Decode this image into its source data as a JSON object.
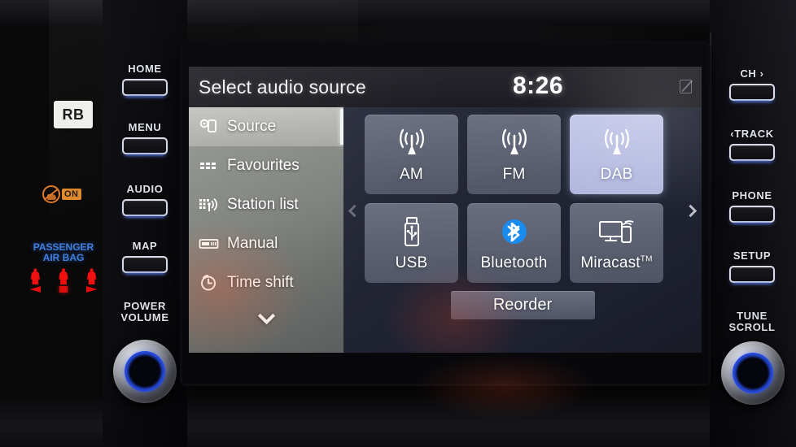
{
  "screen": {
    "title": "Select audio source",
    "clock": "8:26",
    "status_icon": "no-signal-icon"
  },
  "sidebar": {
    "items": [
      {
        "label": "Source",
        "icon": "source-icon",
        "active": true
      },
      {
        "label": "Favourites",
        "icon": "favourites-icon",
        "active": false
      },
      {
        "label": "Station list",
        "icon": "station-list-icon",
        "active": false
      },
      {
        "label": "Manual",
        "icon": "manual-icon",
        "active": false
      },
      {
        "label": "Time shift",
        "icon": "time-shift-icon",
        "active": false
      }
    ],
    "more_icon": "chevron-down-icon"
  },
  "sources": {
    "row1": [
      {
        "label": "AM",
        "icon": "radio-antenna-icon",
        "selected": false
      },
      {
        "label": "FM",
        "icon": "radio-antenna-icon",
        "selected": false
      },
      {
        "label": "DAB",
        "icon": "radio-antenna-icon",
        "selected": true
      }
    ],
    "row2": [
      {
        "label": "USB",
        "icon": "usb-stick-icon",
        "selected": false
      },
      {
        "label": "Bluetooth",
        "icon": "bluetooth-icon",
        "selected": false
      },
      {
        "label": "Miracast",
        "icon": "miracast-icon",
        "selected": false,
        "suffix": "TM"
      }
    ],
    "prev_icon": "chevron-left-icon",
    "next_icon": "chevron-right-icon",
    "reorder_label": "Reorder"
  },
  "hardware": {
    "left": [
      {
        "label": "HOME"
      },
      {
        "label": "MENU"
      },
      {
        "label": "AUDIO"
      },
      {
        "label": "MAP"
      }
    ],
    "left_knob_label_line1": "POWER",
    "left_knob_label_line2": "VOLUME",
    "right": [
      {
        "label": "CH ›"
      },
      {
        "label": "‹TRACK"
      },
      {
        "label": "PHONE"
      },
      {
        "label": "SETUP"
      }
    ],
    "right_knob_label_line1": "TUNE",
    "right_knob_label_line2": "SCROLL"
  },
  "dash_indicators": {
    "rb_badge": "RB",
    "airbag_off_state": "ON",
    "passenger_airbag_line1": "PASSENGER",
    "passenger_airbag_line2": "AIR BAG"
  },
  "colors": {
    "selected_tile": "#b8bde0",
    "bluetooth_blue": "#1a8cf0",
    "airbag_orange": "#e08a2c",
    "airbag_blue": "#3f7fe0",
    "knob_blue": "#2a4fe0"
  }
}
